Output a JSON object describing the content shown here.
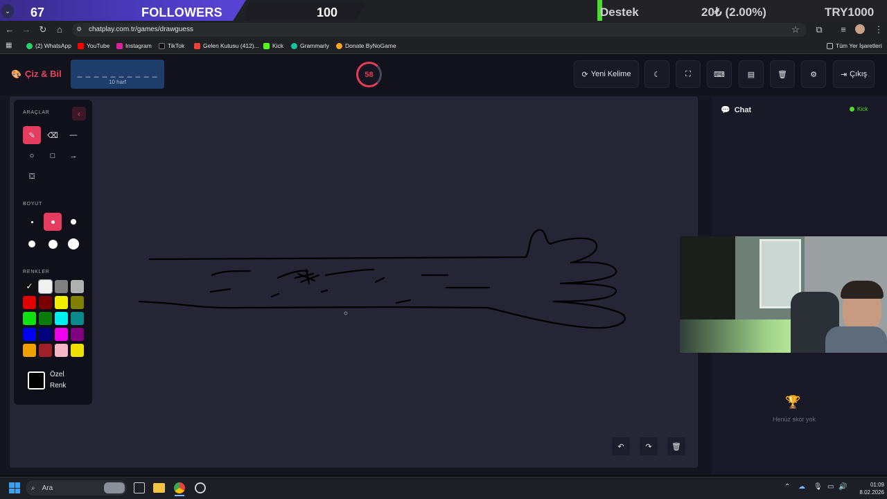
{
  "overlay": {
    "followers_count": "67",
    "followers_label": "FOLLOWERS",
    "followers_goal": "100",
    "support_label": "Destek",
    "support_amount": "20₺ (2.00%)",
    "support_goal": "TRY1000"
  },
  "browser": {
    "url": "chatplay.com.tr/games/drawguess",
    "bookmarks": [
      "(2) WhatsApp",
      "YouTube",
      "Instagram",
      "TikTok",
      "Gelen Kutusu (412)...",
      "Kick",
      "Grammarly",
      "Donate ByNoGame"
    ],
    "all_bookmarks": "Tüm Yer İşaretleri"
  },
  "app": {
    "brand": "Çiz & Bil",
    "word_dashes": "_ _ _ _ _ _ _ _ _ _",
    "word_hint": "10 harf",
    "timer": "58",
    "new_word": "Yeni Kelime",
    "exit": "Çıkış"
  },
  "tools": {
    "section_tools": "ARAÇLAR",
    "section_size": "BOYUT",
    "section_colors": "RENKLER",
    "custom_color_line1": "Özel",
    "custom_color_line2": "Renk",
    "colors": [
      "#111111",
      "#f0f0f0",
      "#808080",
      "#b0b0b0",
      "#e00000",
      "#7a0000",
      "#f4ef00",
      "#808000",
      "#10e010",
      "#0a7a0a",
      "#00f0f0",
      "#0a8a8a",
      "#0000f0",
      "#000080",
      "#f000f0",
      "#800080",
      "#f0a000",
      "#a0202a",
      "#f5b7c8",
      "#f0e000"
    ]
  },
  "chat": {
    "title": "Chat",
    "platform": "Kick",
    "empty_scores": "Henüz skor yok"
  },
  "taskbar": {
    "search": "Ara",
    "time": "01:09",
    "date": "8.02.2026"
  }
}
